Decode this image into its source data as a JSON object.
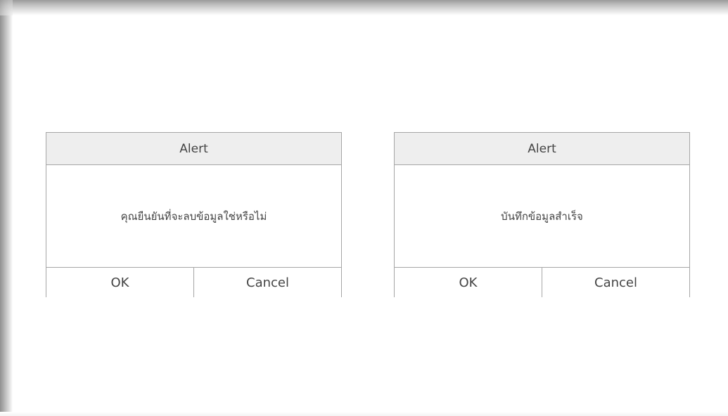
{
  "dialogs": [
    {
      "title": "Alert",
      "message": "คุณยืนยันที่จะลบข้อมูลใช่หรือไม่",
      "ok_label": "OK",
      "cancel_label": "Cancel"
    },
    {
      "title": "Alert",
      "message": "บันทึกข้อมูลสำเร็จ",
      "ok_label": "OK",
      "cancel_label": "Cancel"
    }
  ]
}
